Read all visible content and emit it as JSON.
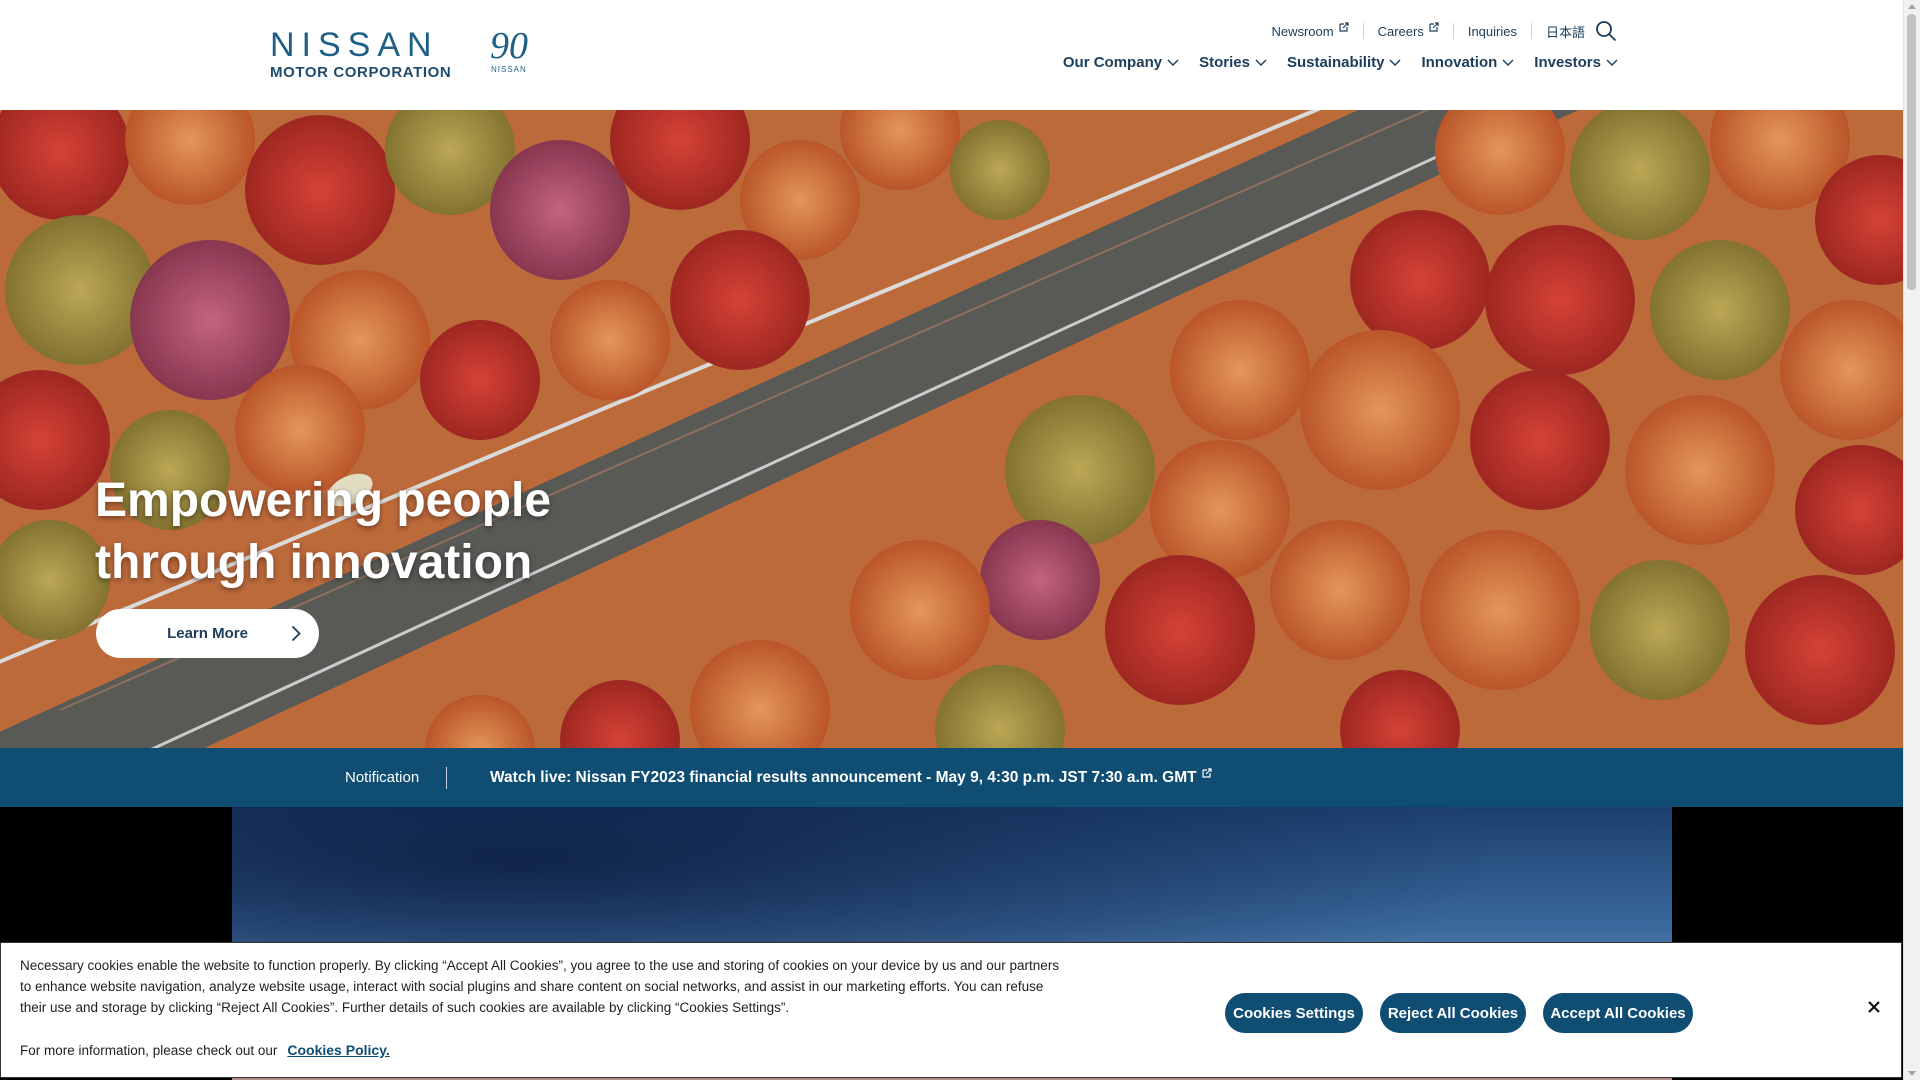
{
  "header": {
    "logo": {
      "main": "NISSAN",
      "sub": "MOTOR CORPORATION",
      "badge_number": "90",
      "badge_text": "NISSAN"
    },
    "utility_nav": [
      {
        "label": "Newsroom",
        "external": true
      },
      {
        "label": "Careers",
        "external": true
      },
      {
        "label": "Inquiries",
        "external": false
      },
      {
        "label": "日本語",
        "external": false
      }
    ],
    "search_icon": "search-icon",
    "main_nav": [
      {
        "label": "Our Company"
      },
      {
        "label": "Stories"
      },
      {
        "label": "Sustainability"
      },
      {
        "label": "Innovation"
      },
      {
        "label": "Investors"
      }
    ]
  },
  "hero": {
    "title_line1": "Empowering people",
    "title_line2": "through innovation",
    "cta_label": "Learn More"
  },
  "notification": {
    "label": "Notification",
    "text": "Watch live: Nissan FY2023 financial results announcement - May 9, 4:30 p.m. JST 7:30 a.m. GMT"
  },
  "cookie_banner": {
    "text": "Necessary cookies enable the website to function properly. By clicking “Accept All Cookies”, you agree to the use and storing of cookies on your device by us and our partners to enhance website navigation, analyze website usage, interact with social plugins and share content on social networks, and assist in our marketing efforts. You can refuse their use and storage by clicking “Reject All Cookies”. Further details of such cookies are available by clicking “Cookies Settings”.",
    "more_info": "For more information, please check out our",
    "policy_link": "Cookies Policy.",
    "settings_button": "Cookies Settings",
    "reject_button": "Reject All Cookies",
    "accept_button": "Accept All Cookies"
  },
  "colors": {
    "brand_blue": "#0f4d73",
    "nav_text": "#1b3d5a",
    "logo_blue": "#1e5f86"
  }
}
